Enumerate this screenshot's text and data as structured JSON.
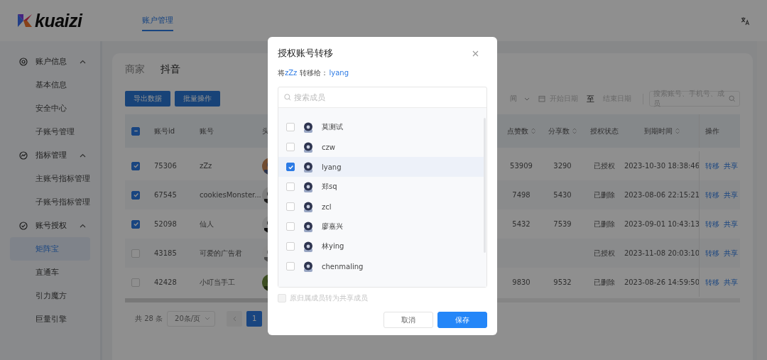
{
  "header": {
    "logo": "kuaizi",
    "nav": [
      {
        "label": "账户管理",
        "selected": true
      }
    ]
  },
  "sidebar": {
    "groups": [
      {
        "label": "账户信息",
        "kind": "target",
        "expanded": true,
        "items": [
          {
            "label": "基本信息",
            "selected": false
          },
          {
            "label": "安全中心",
            "selected": false
          },
          {
            "label": "子账号管理",
            "selected": false
          }
        ]
      },
      {
        "label": "指标管理",
        "kind": "chart",
        "expanded": true,
        "items": [
          {
            "label": "主账号指标管理",
            "selected": false
          },
          {
            "label": "子账号指标管理",
            "selected": false
          }
        ]
      },
      {
        "label": "账号授权",
        "kind": "shield",
        "expanded": true,
        "items": [
          {
            "label": "矩阵宝",
            "selected": true
          },
          {
            "label": "直通车",
            "selected": false
          },
          {
            "label": "引力魔方",
            "selected": false
          },
          {
            "label": "巨量引擎",
            "selected": false
          }
        ]
      }
    ]
  },
  "platform_tabs": [
    {
      "label": "商家",
      "selected": false
    },
    {
      "label": "抖音",
      "selected": true
    }
  ],
  "actions": [
    "导出数据",
    "批量操作"
  ],
  "filter": {
    "type_select": "间",
    "start_placeholder": "开始日期",
    "separator": "至",
    "end_placeholder": "结束日期",
    "search_placeholder": "搜索账号、手机号、成员"
  },
  "table": {
    "select_all": {
      "indeterminate": true
    },
    "columns": [
      {
        "label": "账号id",
        "sortable": false
      },
      {
        "label": "账号",
        "sortable": false
      },
      {
        "label": "头",
        "sortable": false
      },
      {
        "label": "点赞数",
        "sortable": true
      },
      {
        "label": "分享数",
        "sortable": true
      },
      {
        "label": "授权状态",
        "sortable": false
      },
      {
        "label": "到期时间",
        "sortable": true
      },
      {
        "label": "操作",
        "sortable": false
      }
    ],
    "rows": [
      {
        "checked": true,
        "id": "75306",
        "account": "zZz",
        "avatar": {
          "kind": "picture"
        },
        "likes": "53909",
        "shares": "3290",
        "status": "已授权",
        "expiry": "2023-10-30 18:38:46",
        "ops": [
          "转移",
          "共享"
        ]
      },
      {
        "checked": true,
        "id": "67545",
        "account": "cookiesMonster...",
        "avatar": {
          "kind": "picture"
        },
        "likes": "7498",
        "shares": "5430",
        "status": "已删除",
        "expiry": "2023-08-06 22:15:21",
        "ops": [
          "转移",
          "共享"
        ]
      },
      {
        "checked": true,
        "id": "52098",
        "account": "仙人",
        "avatar": {
          "kind": "picture"
        },
        "likes": "5432",
        "shares": "7539",
        "status": "已删除",
        "expiry": "2023-09-01 10:43:13",
        "ops": [
          "转移",
          "共享"
        ]
      },
      {
        "checked": false,
        "id": "43185",
        "account": "可爱的广告君",
        "avatar": {
          "kind": "picture"
        },
        "status": "已授权",
        "expiry": "2023-11-08 20:03:10",
        "ops": [
          "转移",
          "共享"
        ]
      },
      {
        "checked": false,
        "id": "42428",
        "account": "小叮当手工",
        "avatar": {
          "kind": "picture"
        },
        "likes": "9830",
        "shares": "9532",
        "status": "已删除",
        "expiry": "2023-08-26 14:59:50",
        "ops": [
          "转移",
          "共享"
        ]
      }
    ]
  },
  "pagination": {
    "total": "共 28 条",
    "page_size": "20条/页",
    "pages": [
      {
        "label": "1",
        "selected": true
      }
    ]
  },
  "modal": {
    "title": "授权账号转移",
    "subtitle": {
      "prefix": "将",
      "source": "zZz",
      "middle": " 转移给：",
      "target": "lyang"
    },
    "search_placeholder": "搜索成员",
    "members": [
      {
        "name": "莫测试",
        "checked": false
      },
      {
        "name": "czw",
        "checked": false
      },
      {
        "name": "lyang",
        "checked": true
      },
      {
        "name": "郑sq",
        "checked": false
      },
      {
        "name": "zcl",
        "checked": false
      },
      {
        "name": "廖嘉兴",
        "checked": false
      },
      {
        "name": "林ying",
        "checked": false
      },
      {
        "name": "chenmaling",
        "checked": false
      }
    ],
    "keep_shared": {
      "label": "原归属成员转为共享成员",
      "checked": false,
      "disabled": true
    },
    "buttons": [
      {
        "label": "取消",
        "kind": "default"
      },
      {
        "label": "保存",
        "kind": "primary"
      }
    ]
  }
}
